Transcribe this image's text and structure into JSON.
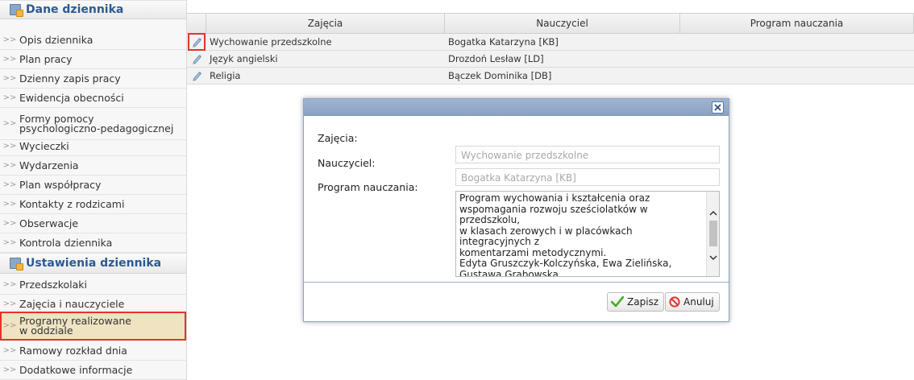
{
  "sidebar": {
    "section1_title": "Dane dziennika",
    "section1_items": [
      "Opis dziennika",
      "Plan pracy",
      "Dzienny zapis pracy",
      "Ewidencja obecności",
      "Formy pomocy\npsychologiczno-pedagogicznej",
      "Wycieczki",
      "Wydarzenia",
      "Plan współpracy",
      "Kontakty z rodzicami",
      "Obserwacje",
      "Kontrola dziennika"
    ],
    "section2_title": "Ustawienia dziennika",
    "section2_items": [
      "Przedszkolaki",
      "Zajęcia i nauczyciele",
      "Programy realizowane\nw oddziale",
      "Ramowy rozkład dnia",
      "Dodatkowe informacje"
    ],
    "chevron": ">>"
  },
  "table": {
    "columns": [
      "Zajęcia",
      "Nauczyciel",
      "Program nauczania"
    ],
    "rows": [
      {
        "zajecia": "Wychowanie przedszkolne",
        "nauczyciel": "Bogatka Katarzyna [KB]",
        "program": ""
      },
      {
        "zajecia": "Język angielski",
        "nauczyciel": "Drozdoń Lesław [LD]",
        "program": ""
      },
      {
        "zajecia": "Religia",
        "nauczyciel": "Bączek Dominika [DB]",
        "program": ""
      }
    ]
  },
  "dialog": {
    "zajecia_label": "Zajęcia:",
    "zajecia_value": "Wychowanie przedszkolne",
    "nauczyciel_label": "Nauczyciel:",
    "nauczyciel_value": "Bogatka Katarzyna [KB]",
    "program_label": "Program nauczania:",
    "program_text": "Program wychowania i kształcenia oraz\nwspomagania rozwoju sześciolatków w przedszkolu,\nw klasach zerowych i w placówkach integracyjnych z\nkomentarzami metodycznymi.\nEdyta Gruszczyk-Kolczyńska, Ewa Zielińska,\nGustawa Grabowska\nWydawnictwo NOWA ERA",
    "save_label": "Zapisz",
    "cancel_label": "Anuluj"
  },
  "colors": {
    "highlight": "#e8312a",
    "active_item_bg": "#efe3c2",
    "header_text": "#2b5a92",
    "dialog_titlebar": "#8aa2c2"
  }
}
